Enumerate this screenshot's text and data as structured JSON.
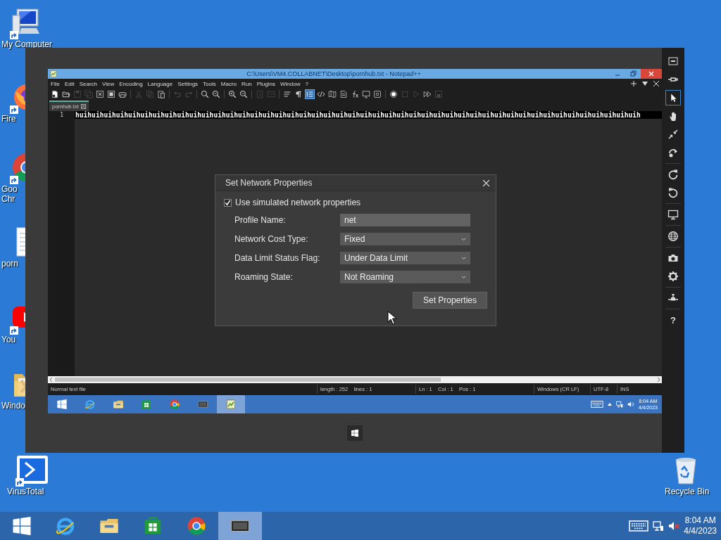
{
  "desktop_icons": [
    {
      "label": "My Computer",
      "kind": "computer",
      "shortcut": true
    },
    {
      "label": "Fire",
      "kind": "firefox",
      "shortcut": true
    },
    {
      "label": "Goo",
      "label_2": "Chr",
      "kind": "chrome",
      "shortcut": true
    },
    {
      "label": "porn",
      "kind": "textfile",
      "shortcut": false
    },
    {
      "label": "You",
      "kind": "video",
      "shortcut": true
    },
    {
      "label": "Windo",
      "kind": "folder",
      "shortcut": false
    },
    {
      "label": "VirusTotal",
      "kind": "virustotal",
      "shortcut": true
    },
    {
      "label": "Recycle Bin",
      "kind": "recycle",
      "shortcut": false
    }
  ],
  "simulator": {
    "toolbar_groups": [
      [
        {
          "kind": "minimize",
          "selected": false
        },
        {
          "kind": "pin",
          "selected": false
        },
        {
          "kind": "pointer",
          "selected": true
        },
        {
          "kind": "hand",
          "selected": false
        },
        {
          "kind": "pinch",
          "selected": false
        },
        {
          "kind": "rotate-touch",
          "selected": false
        }
      ],
      [
        {
          "kind": "rotate-cw",
          "selected": false
        },
        {
          "kind": "rotate-ccw",
          "selected": false
        }
      ],
      [
        {
          "kind": "monitor",
          "selected": false
        }
      ],
      [
        {
          "kind": "globe",
          "selected": false
        }
      ],
      [
        {
          "kind": "camera",
          "selected": false
        },
        {
          "kind": "gear",
          "selected": false
        }
      ],
      [
        {
          "kind": "network",
          "selected": false
        }
      ]
    ],
    "help": "?"
  },
  "notepad": {
    "title": "C:\\Users\\VM4.COLLABNET\\Desktop\\pornhub.txt - Notepad++",
    "menu": [
      "File",
      "Edit",
      "Search",
      "View",
      "Encoding",
      "Language",
      "Settings",
      "Tools",
      "Macro",
      "Run",
      "Plugins",
      "Window",
      "?"
    ],
    "toolbar": [
      {
        "kind": "new",
        "disabled": false,
        "selected": false
      },
      {
        "kind": "open",
        "disabled": false,
        "selected": false
      },
      {
        "kind": "save",
        "disabled": true,
        "selected": false
      },
      {
        "kind": "save-all",
        "disabled": true,
        "selected": false
      },
      {
        "kind": "close",
        "disabled": false,
        "selected": false
      },
      {
        "kind": "close-all",
        "disabled": false,
        "selected": false
      },
      {
        "kind": "print",
        "disabled": false,
        "selected": false
      },
      {
        "kind": "separator"
      },
      {
        "kind": "cut",
        "disabled": true,
        "selected": false
      },
      {
        "kind": "copy",
        "disabled": true,
        "selected": false
      },
      {
        "kind": "paste",
        "disabled": false,
        "selected": false
      },
      {
        "kind": "separator"
      },
      {
        "kind": "undo",
        "disabled": true,
        "selected": false
      },
      {
        "kind": "redo",
        "disabled": true,
        "selected": false
      },
      {
        "kind": "separator"
      },
      {
        "kind": "find",
        "disabled": false,
        "selected": false
      },
      {
        "kind": "replace",
        "disabled": false,
        "selected": false
      },
      {
        "kind": "separator"
      },
      {
        "kind": "zoom-in",
        "disabled": false,
        "selected": false
      },
      {
        "kind": "zoom-out",
        "disabled": false,
        "selected": false
      },
      {
        "kind": "separator"
      },
      {
        "kind": "sync-v",
        "disabled": true,
        "selected": false
      },
      {
        "kind": "sync-h",
        "disabled": true,
        "selected": false
      },
      {
        "kind": "separator"
      },
      {
        "kind": "wrap",
        "disabled": false,
        "selected": false
      },
      {
        "kind": "all-chars",
        "disabled": false,
        "selected": false
      },
      {
        "kind": "indent-guide",
        "disabled": false,
        "selected": true
      },
      {
        "kind": "code",
        "disabled": false,
        "selected": false
      },
      {
        "kind": "doc-map",
        "disabled": false,
        "selected": false
      },
      {
        "kind": "doc-list",
        "disabled": false,
        "selected": false
      },
      {
        "kind": "function",
        "disabled": false,
        "selected": false
      },
      {
        "kind": "monitor",
        "disabled": false,
        "selected": false
      },
      {
        "kind": "workspace",
        "disabled": false,
        "selected": false
      },
      {
        "kind": "separator"
      },
      {
        "kind": "record",
        "disabled": false,
        "selected": false
      },
      {
        "kind": "stop",
        "disabled": true,
        "selected": false
      },
      {
        "kind": "play",
        "disabled": true,
        "selected": false
      },
      {
        "kind": "play-multi",
        "disabled": false,
        "selected": false
      },
      {
        "kind": "save-macro",
        "disabled": true,
        "selected": false
      }
    ],
    "tab": {
      "label": "pornhub.txt",
      "selected": true
    },
    "lines": [
      {
        "number": "1",
        "text": "huihuihuihuihuihuihuihuihuihuihuihuihuihuihuihuihuihuihuihuihuihuihuihuihuihuihuihuihuihuihuihuihuihuihuihuihuihuihuihuihuihuihuihuihuihuih"
      }
    ],
    "status": [
      "Normal text file",
      "length : 252    lines : 1",
      "Ln : 1    Col : 1    Pos : 1",
      "Windows (CR LF)",
      "UTF-8",
      "INS"
    ],
    "taskbar": {
      "apps": [
        {
          "kind": "start",
          "selected": false
        },
        {
          "kind": "ie",
          "selected": false
        },
        {
          "kind": "explorer",
          "selected": false
        },
        {
          "kind": "store",
          "selected": false
        },
        {
          "kind": "chrome",
          "selected": false
        },
        {
          "kind": "simulator",
          "selected": false
        },
        {
          "kind": "notepadpp",
          "selected": true
        }
      ],
      "time": "8:04 AM",
      "date": "4/4/2023"
    }
  },
  "dialog": {
    "title": "Set Network Properties",
    "checkbox": {
      "label": "Use simulated network properties",
      "checked": true
    },
    "fields": [
      {
        "label": "Profile Name:",
        "kind": "text",
        "value": "net"
      },
      {
        "label": "Network Cost Type:",
        "kind": "dropdown",
        "value": "Fixed"
      },
      {
        "label": "Data Limit Status Flag:",
        "kind": "dropdown",
        "value": "Under Data Limit"
      },
      {
        "label": "Roaming State:",
        "kind": "dropdown",
        "value": "Not Roaming"
      }
    ],
    "button": "Set Properties"
  },
  "taskbar": {
    "apps": [
      {
        "kind": "start",
        "selected": false
      },
      {
        "kind": "ie",
        "selected": false
      },
      {
        "kind": "explorer",
        "selected": false
      },
      {
        "kind": "store",
        "selected": false
      },
      {
        "kind": "chrome",
        "selected": false
      },
      {
        "kind": "simulator",
        "selected": true
      }
    ],
    "time": "8:04 AM",
    "date": "4/4/2023"
  }
}
